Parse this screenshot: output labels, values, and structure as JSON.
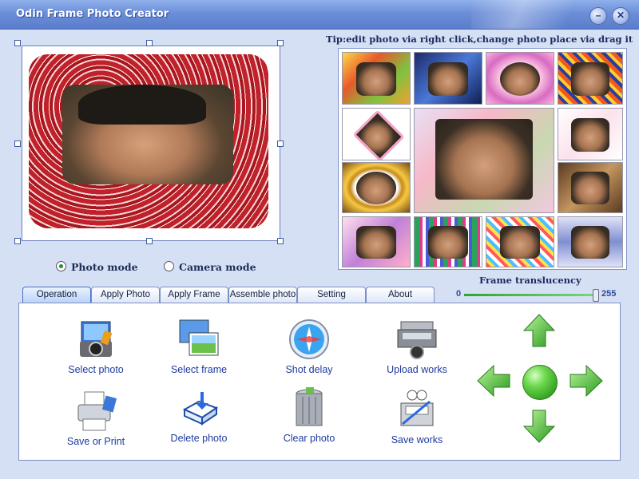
{
  "window": {
    "title": "Odin Frame Photo Creator"
  },
  "modes": {
    "photo": "Photo mode",
    "camera": "Camera mode",
    "selected": "photo"
  },
  "tip": "Tip:edit photo via right click,change photo place via drag it",
  "translucency": {
    "label": "Frame translucency",
    "min": "0",
    "max": "255",
    "value": 255
  },
  "tabs": [
    "Operation",
    "Apply Photo",
    "Apply Frame",
    "Assemble photo",
    "Setting",
    "About"
  ],
  "active_tab": "Operation",
  "operations": {
    "select_photo": "Select photo",
    "select_frame": "Select frame",
    "shot_delay": "Shot delay",
    "upload_works": "Upload works",
    "save_or_print": "Save or Print",
    "delete_photo": "Delete photo",
    "clear_photo": "Clear photo",
    "save_works": "Save works"
  },
  "icons": {
    "select_photo": "camera-photo-icon",
    "select_frame": "picture-frames-icon",
    "shot_delay": "compass-clock-icon",
    "upload_works": "upload-machine-icon",
    "save_or_print": "printer-icon",
    "delete_photo": "disk-delete-icon",
    "clear_photo": "trash-bin-icon",
    "save_works": "save-pen-icon",
    "nav": [
      "arrow-up-icon",
      "arrow-left-icon",
      "center-ball-icon",
      "arrow-right-icon",
      "arrow-down-icon"
    ]
  },
  "colors": {
    "title_bar": "#6c8ed8",
    "label_blue": "#1d3a9e",
    "arrow_green": "#3cb02a"
  }
}
